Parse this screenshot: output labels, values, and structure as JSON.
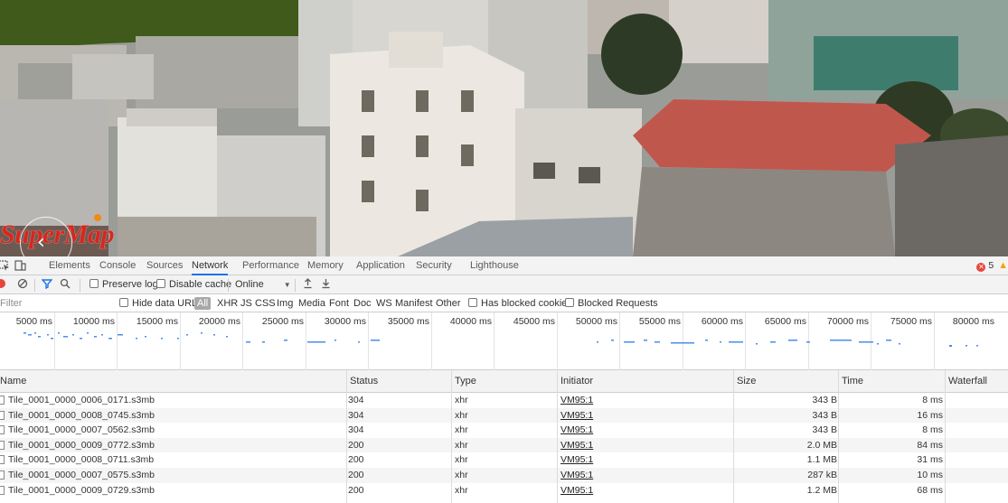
{
  "scene": {
    "logo_text": "SuperMap",
    "nav_arrow_icon": "chevron-left-icon",
    "colors": {
      "roof_red": "#c0574d",
      "sky_green": "#3f5a1a",
      "logo_red": "#d8261d"
    }
  },
  "devtools": {
    "tabs": [
      {
        "label": "Elements"
      },
      {
        "label": "Console"
      },
      {
        "label": "Sources"
      },
      {
        "label": "Network",
        "active": true
      },
      {
        "label": "Performance"
      },
      {
        "label": "Memory"
      },
      {
        "label": "Application"
      },
      {
        "label": "Security"
      },
      {
        "label": "Lighthouse"
      }
    ],
    "error_count": "5",
    "toolbar": {
      "preserve_log": "Preserve log",
      "disable_cache": "Disable cache",
      "throttling": "Online"
    },
    "filter": {
      "placeholder": "Filter",
      "hide_data_urls": "Hide data URLs",
      "types": [
        "All",
        "XHR",
        "JS",
        "CSS",
        "Img",
        "Media",
        "Font",
        "Doc",
        "WS",
        "Manifest",
        "Other"
      ],
      "blocked_cookies": "Has blocked cookies",
      "blocked_requests": "Blocked Requests"
    },
    "overview_ticks": [
      "5000 ms",
      "10000 ms",
      "15000 ms",
      "20000 ms",
      "25000 ms",
      "30000 ms",
      "35000 ms",
      "40000 ms",
      "45000 ms",
      "50000 ms",
      "55000 ms",
      "60000 ms",
      "65000 ms",
      "70000 ms",
      "75000 ms",
      "80000 ms"
    ],
    "columns": {
      "name": "Name",
      "status": "Status",
      "type": "Type",
      "initiator": "Initiator",
      "size": "Size",
      "time": "Time",
      "waterfall": "Waterfall"
    },
    "requests": [
      {
        "name": "Tile_0001_0000_0006_0171.s3mb",
        "status": "304",
        "type": "xhr",
        "initiator": "VM95:1",
        "size": "343 B",
        "time": "8 ms"
      },
      {
        "name": "Tile_0001_0000_0008_0745.s3mb",
        "status": "304",
        "type": "xhr",
        "initiator": "VM95:1",
        "size": "343 B",
        "time": "16 ms"
      },
      {
        "name": "Tile_0001_0000_0007_0562.s3mb",
        "status": "304",
        "type": "xhr",
        "initiator": "VM95:1",
        "size": "343 B",
        "time": "8 ms"
      },
      {
        "name": "Tile_0001_0000_0009_0772.s3mb",
        "status": "200",
        "type": "xhr",
        "initiator": "VM95:1",
        "size": "2.0 MB",
        "time": "84 ms"
      },
      {
        "name": "Tile_0001_0000_0008_0711.s3mb",
        "status": "200",
        "type": "xhr",
        "initiator": "VM95:1",
        "size": "1.1 MB",
        "time": "31 ms"
      },
      {
        "name": "Tile_0001_0000_0007_0575.s3mb",
        "status": "200",
        "type": "xhr",
        "initiator": "VM95:1",
        "size": "287 kB",
        "time": "10 ms"
      },
      {
        "name": "Tile_0001_0000_0009_0729.s3mb",
        "status": "200",
        "type": "xhr",
        "initiator": "VM95:1",
        "size": "1.2 MB",
        "time": "68 ms"
      }
    ]
  }
}
